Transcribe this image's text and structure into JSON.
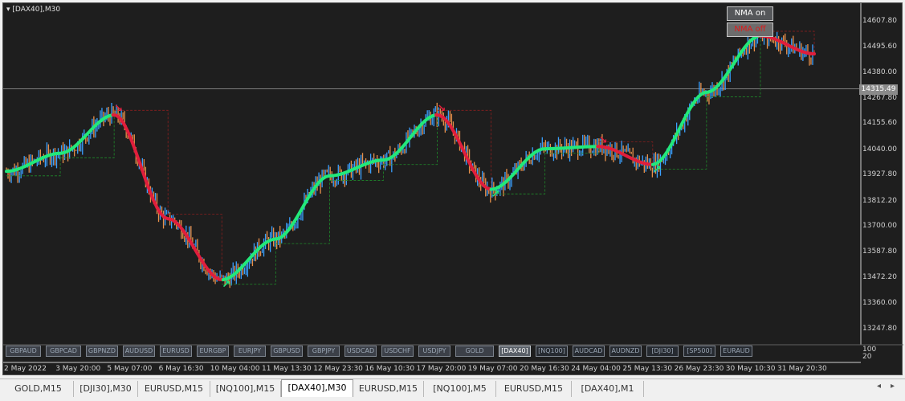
{
  "chart_title": "[DAX40],M30",
  "nma_buttons": {
    "on": "NMA on",
    "off": "NMA off"
  },
  "current_price": "14315.49",
  "y_ticks": [
    "14607.80",
    "14495.60",
    "14380.00",
    "14267.80",
    "14155.60",
    "14040.00",
    "13927.80",
    "13812.20",
    "13700.00",
    "13587.80",
    "13472.20",
    "13360.00",
    "13247.80"
  ],
  "x_ticks": [
    "2 May 2022",
    "3 May 20:00",
    "5 May 07:00",
    "6 May 16:30",
    "10 May 04:00",
    "11 May 13:30",
    "12 May 23:30",
    "16 May 10:30",
    "17 May 20:00",
    "19 May 07:00",
    "20 May 16:30",
    "24 May 04:00",
    "25 May 13:30",
    "26 May 23:30",
    "30 May 10:30",
    "31 May 20:30"
  ],
  "indicator_scale": [
    "100",
    "20"
  ],
  "symbol_buttons": [
    "GBPAUD",
    "GBPCAD",
    "GBPNZD",
    "AUDUSD",
    "EURUSD",
    "EURGBP",
    "EURJPY",
    "GBPUSD",
    "GBPJPY",
    "USDCAD",
    "USDCHF",
    "USDJPY",
    "GOLD",
    "[DAX40]",
    "[NQ100]",
    "AUDCAD",
    "AUDNZD",
    "[DJI30]",
    "[SP500]",
    "EURAUD"
  ],
  "active_symbol": "[DAX40]",
  "tabs": [
    "GOLD,M15",
    "[DJI30],M30",
    "EURUSD,M15",
    "[NQ100],M15",
    "[DAX40],M30",
    "EURUSD,M15",
    "[NQ100],M5",
    "EURUSD,M15",
    "[DAX40],M1"
  ],
  "active_tab": "[DAX40],M30",
  "colors": {
    "background": "#1e1e1e",
    "bull": "#3aa0ff",
    "bear": "#e8904a",
    "nma_up": "#22e87a",
    "nma_down": "#e01e3c"
  },
  "chart_data": {
    "type": "line",
    "title": "[DAX40],M30",
    "xlabel": "",
    "ylabel": "",
    "ylim": [
      13200,
      14680
    ],
    "x": [
      "2 May 2022",
      "3 May 20:00",
      "5 May 07:00",
      "6 May 16:30",
      "10 May 04:00",
      "11 May 13:30",
      "12 May 23:30",
      "16 May 10:30",
      "17 May 20:00",
      "19 May 07:00",
      "20 May 16:30",
      "24 May 04:00",
      "25 May 13:30",
      "26 May 23:30",
      "30 May 10:30",
      "31 May 20:30"
    ],
    "series": [
      {
        "values": [
          13950,
          14030,
          14200,
          13740,
          13470,
          13650,
          13930,
          14000,
          14200,
          13870,
          14050,
          14060,
          13980,
          14300,
          14550,
          14470
        ]
      }
    ],
    "last_price": 14315.49
  }
}
